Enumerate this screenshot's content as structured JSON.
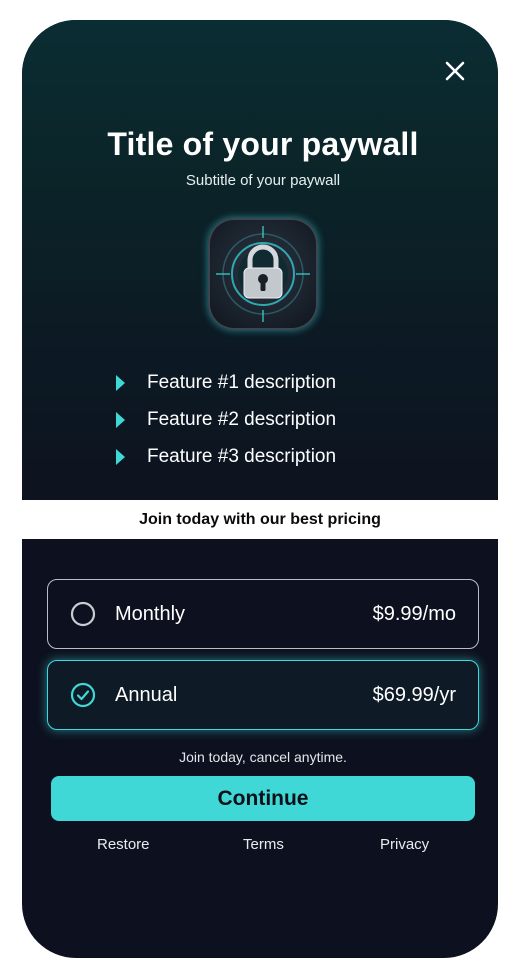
{
  "paywall": {
    "title": "Title of your paywall",
    "subtitle": "Subtitle of your paywall",
    "hero_image": "padlock-icon",
    "close_icon": "close-icon",
    "features": [
      {
        "icon": "triangle-right-icon",
        "label": "Feature #1 description"
      },
      {
        "icon": "triangle-right-icon",
        "label": "Feature #2 description"
      },
      {
        "icon": "triangle-right-icon",
        "label": "Feature #3 description"
      }
    ],
    "banner": "Join today with our best pricing",
    "plans": [
      {
        "name": "Monthly",
        "price": "$9.99/mo",
        "selected": false
      },
      {
        "name": "Annual",
        "price": "$69.99/yr",
        "selected": true
      }
    ],
    "note": "Join today, cancel anytime.",
    "cta_label": "Continue",
    "footer_links": [
      "Restore",
      "Terms",
      "Privacy"
    ]
  },
  "colors": {
    "background": "#0d111f",
    "accent": "#3fd8d6",
    "banner_bg": "#ffffff",
    "unselected_border": "#b9bec6"
  }
}
